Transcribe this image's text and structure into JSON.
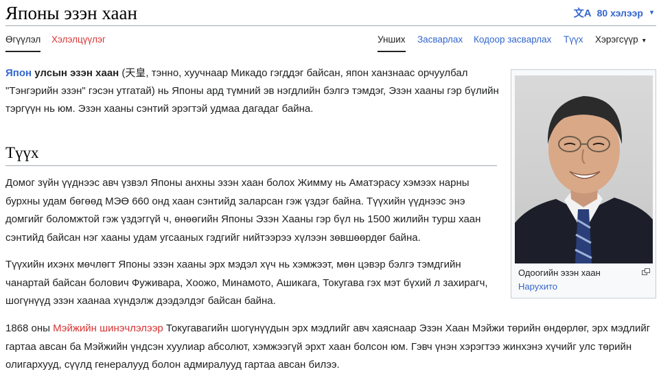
{
  "header": {
    "title": "Японы эзэн хаан",
    "languages_label": "80 хэлээр",
    "translate_icon": "文A"
  },
  "tabs_left": [
    {
      "label": "Өгүүлэл",
      "state": "active"
    },
    {
      "label": "Хэлэлцүүлэг",
      "state": "red"
    }
  ],
  "tabs_right": [
    {
      "label": "Унших",
      "state": "active"
    },
    {
      "label": "Засварлах",
      "state": "link"
    },
    {
      "label": "Кодоор засварлах",
      "state": "link"
    },
    {
      "label": "Түүх",
      "state": "link"
    },
    {
      "label": "Хэрэгсүүр",
      "state": "plain"
    }
  ],
  "intro": {
    "link": "Япон",
    "bold": " улсын эзэн хаан",
    "text": " (天皇, тэнно, хуучнаар Микадо гэгддэг байсан, япон ханзнаас орчуулбал \"Тэнгэрийн эзэн\" гэсэн утгатай) нь Японы ард түмний эв нэгдлийн бэлгэ тэмдэг, Эзэн хааны гэр бүлийн тэргүүн нь юм. Эзэн хааны сэнтий эрэгтэй удмаа дагадаг байна."
  },
  "section": {
    "heading": "Түүх",
    "p1": "Домог зүйн үүднээс авч үзвэл Японы анхны эзэн хаан болох Жимму нь Аматэрасу хэмээх нарны бурхны удам бөгөөд МЭӨ 660 онд хаан сэнтийд заларсан гэж үздэг байна. Түүхийн үүднээс энэ домгийг боломжтой гэж үздэггүй ч, өнөөгийн Японы Эзэн Хааны гэр бүл нь 1500 жилийн турш хаан сэнтийд байсан нэг хааны удам угсааных гэдгийг нийтээрээ хүлээн зөвшөөрдөг байна.",
    "p2": "Түүхийн ихэнх мөчлөгт Японы эзэн хааны эрх мэдэл хүч нь хэмжээт, мөн цэвэр бэлгэ тэмдгийн чанартай байсан болович Фуживара, Хоожо, Минамото, Ашикага, Токугава гэх мэт бүхий л захирагч, шогүнүүд эзэн хаанаа хүндэлж дээдэлдэг байсан байна.",
    "p3_start": "1868 оны ",
    "p3_link": "Мэйжийн шинэчлэлээр",
    "p3_rest": " Токугавагийн шогүнүүдын эрх мэдлийг авч хаяснаар Эзэн Хаан Мэйжи төрийн өндөрлөг, эрх мэдлийг гартаа авсан ба Мэйжийн үндсэн хуулиар абсолют, хэмжээгүй эрхт хаан болсон юм. Гэвч үнэн хэрэгтээ жинхэнэ хүчийг улс төрийн олигархууд, сүүлд генералууд болон адмиралууд гартаа авсан билээ."
  },
  "infobox": {
    "caption": "Одоогийн эзэн хаан",
    "name_link": "Нарухито",
    "image_icon": "portrait-photo",
    "enlarge_icon": "enlarge-icon"
  },
  "colors": {
    "link": "#3366cc",
    "redlink": "#d73333",
    "text": "#202122",
    "border": "#a2a9b1"
  }
}
